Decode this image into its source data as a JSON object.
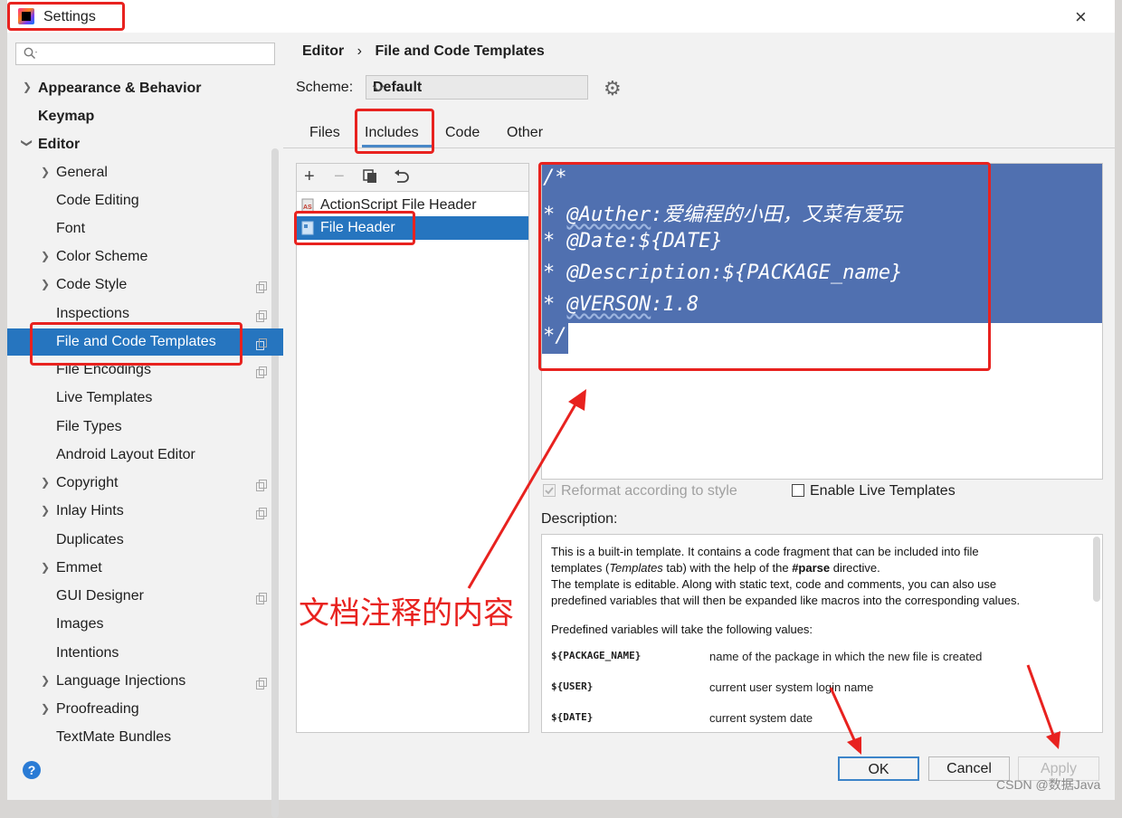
{
  "window": {
    "title": "Settings",
    "close_glyph": "×"
  },
  "search": {
    "placeholder": ""
  },
  "sidebar": {
    "items": [
      {
        "label": "Appearance & Behavior"
      },
      {
        "label": "Keymap"
      },
      {
        "label": "Editor"
      },
      {
        "label": "General"
      },
      {
        "label": "Code Editing"
      },
      {
        "label": "Font"
      },
      {
        "label": "Color Scheme"
      },
      {
        "label": "Code Style"
      },
      {
        "label": "Inspections"
      },
      {
        "label": "File and Code Templates"
      },
      {
        "label": "File Encodings"
      },
      {
        "label": "Live Templates"
      },
      {
        "label": "File Types"
      },
      {
        "label": "Android Layout Editor"
      },
      {
        "label": "Copyright"
      },
      {
        "label": "Inlay Hints"
      },
      {
        "label": "Duplicates"
      },
      {
        "label": "Emmet"
      },
      {
        "label": "GUI Designer"
      },
      {
        "label": "Images"
      },
      {
        "label": "Intentions"
      },
      {
        "label": "Language Injections"
      },
      {
        "label": "Proofreading"
      },
      {
        "label": "TextMate Bundles"
      }
    ]
  },
  "breadcrumb": {
    "parent": "Editor",
    "separator": "›",
    "current": "File and Code Templates"
  },
  "scheme": {
    "label": "Scheme:",
    "value": "Default"
  },
  "tabs": [
    {
      "label": "Files"
    },
    {
      "label": "Includes"
    },
    {
      "label": "Code"
    },
    {
      "label": "Other"
    }
  ],
  "template_list": {
    "items": [
      {
        "label": "ActionScript File Header"
      },
      {
        "label": "File Header"
      }
    ]
  },
  "editor": {
    "lines": [
      {
        "before": "/*",
        "tag": "",
        "after": ""
      },
      {
        "before": "* ",
        "tag": "@Auther",
        "after": ":",
        "cjk": "爱编程的小田，又菜有爱玩"
      },
      {
        "before": "* ",
        "tag": "@Date",
        "after": ":${DATE}"
      },
      {
        "before": "* ",
        "tag": "@Description",
        "after": ":${PACKAGE_name}"
      },
      {
        "before": "* ",
        "tag": "@VERSON",
        "after": ":1.8"
      },
      {
        "before": "*/",
        "tag": "",
        "after": ""
      }
    ]
  },
  "options": {
    "reformat_label": "Reformat according to style",
    "reformat_checked": true,
    "live_templates_label": "Enable Live Templates",
    "live_templates_checked": false
  },
  "description": {
    "label": "Description:",
    "line1": "This is a built-in template. It contains a code fragment that can be included into file",
    "line2_pre": "templates (",
    "line2_em": "Templates",
    "line2_mid": " tab) with the help of the ",
    "line2_bold": "#parse",
    "line2_post": " directive.",
    "line3": "The template is editable. Along with static text, code and comments, you can also use",
    "line4": "predefined variables that will then be expanded like macros into the corresponding values.",
    "line5": "Predefined variables will take the following values:",
    "variables": [
      {
        "name": "${PACKAGE_NAME}",
        "desc": "name of the package in which the new file is created"
      },
      {
        "name": "${USER}",
        "desc": "current user system login name"
      },
      {
        "name": "${DATE}",
        "desc": "current system date"
      }
    ]
  },
  "buttons": {
    "ok": "OK",
    "cancel": "Cancel",
    "apply": "Apply",
    "help": "?"
  },
  "annotation": {
    "text": "文档注释的内容",
    "color": "#e8221f"
  },
  "watermark": {
    "text": "CSDN @数据Java"
  },
  "colors": {
    "selection": "#2675bf",
    "editor_selection": "#5070b0",
    "annotation_red": "#e8221f"
  }
}
